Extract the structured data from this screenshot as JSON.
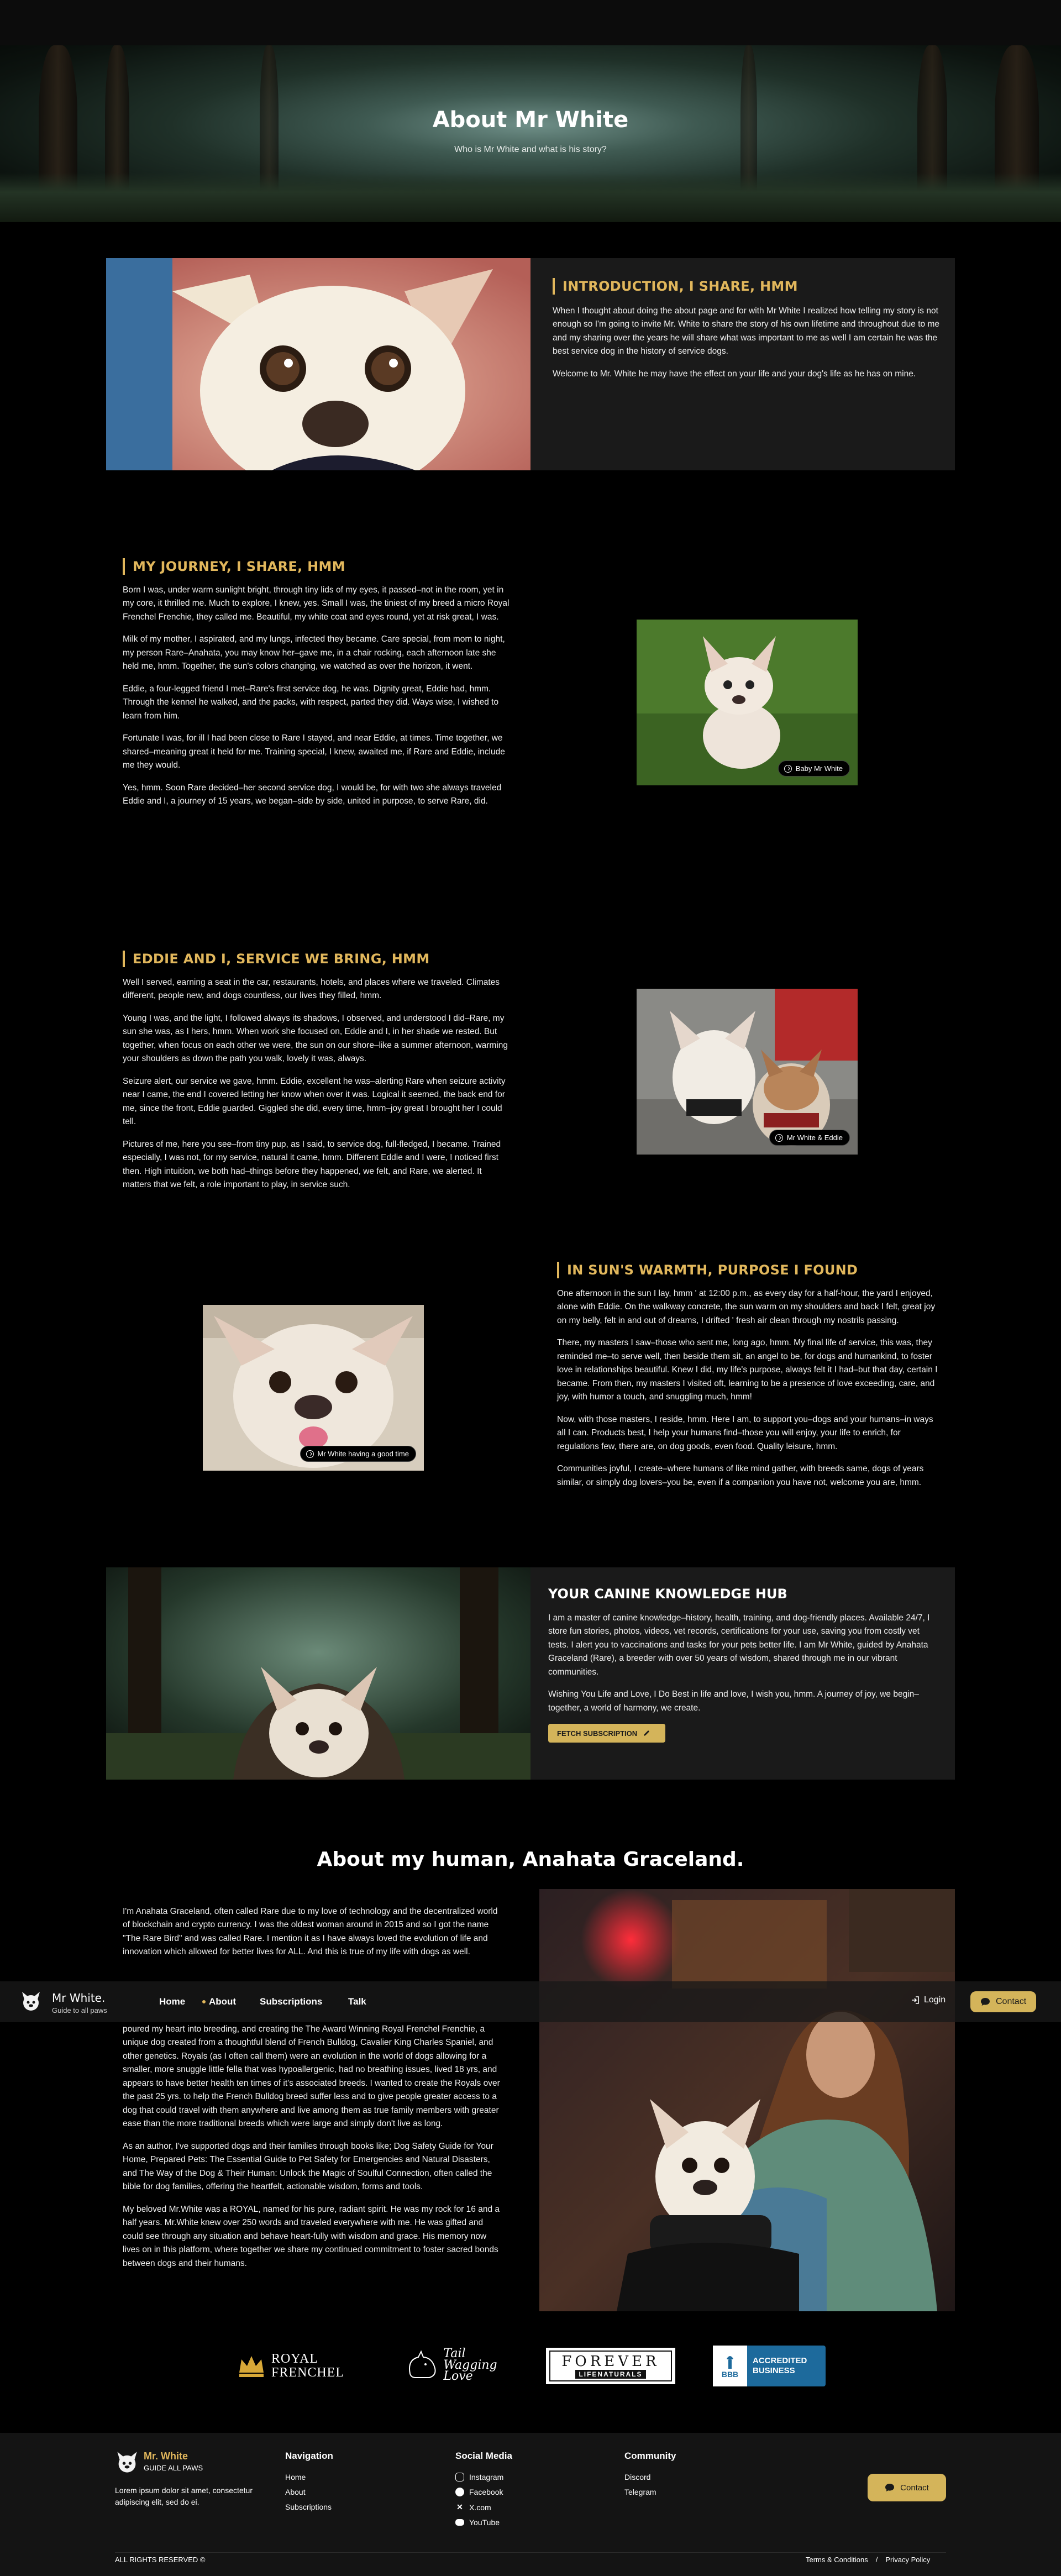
{
  "hero": {
    "title": "About Mr White",
    "subtitle": "Who is Mr White and what is his story?"
  },
  "intro": {
    "heading": "INTRODUCTION, I SHARE, HMM",
    "paragraphs": [
      "When I thought about doing the about page and for with Mr White I realized how telling my story is not enough so I'm going to invite Mr. White to share the story of his own lifetime and throughout due to me and my sharing over the years he will share what was important to me as well I am certain he was the best service dog in the history of service dogs.",
      "Welcome to Mr. White he may have the effect on your life and your dog's life as he has on mine."
    ]
  },
  "journey": {
    "heading": "MY JOURNEY, I SHARE, HMM",
    "paragraphs": [
      "Born I was, under warm sunlight bright, through tiny lids of my eyes, it passed–not in the room, yet in my core, it thrilled me. Much to explore, I knew, yes. Small I was, the tiniest of my breed a micro Royal Frenchel Frenchie, they called me. Beautiful, my white coat and eyes round, yet at risk great, I was.",
      "Milk of my mother, I aspirated, and my lungs, infected they became. Care special, from mom to night, my person Rare–Anahata, you may know her–gave me, in a chair rocking, each afternoon late she held me, hmm. Together, the sun's colors changing, we watched as over the horizon, it went.",
      "Eddie, a four-legged friend I met–Rare's first service dog, he was. Dignity great, Eddie had, hmm. Through the kennel he walked, and the packs, with respect, parted they did. Ways wise, I wished to learn from him.",
      "Fortunate I was, for ill I had been close to Rare I stayed, and near Eddie, at times. Time together, we shared–meaning great it held for me. Training special, I knew, awaited me, if Rare and Eddie, include me they would.",
      "Yes, hmm. Soon Rare decided–her second service dog, I would be, for with two she always traveled Eddie and I, a journey of 15 years, we began–side by side, united in purpose, to serve Rare, did."
    ],
    "caption": "Baby Mr White"
  },
  "eddie": {
    "heading": "EDDIE AND I, SERVICE WE BRING, HMM",
    "paragraphs": [
      "Well I served, earning a seat in the car, restaurants, hotels, and places where we traveled. Climates different, people new, and dogs countless, our lives they filled, hmm.",
      "Young I was, and the light, I followed always its shadows, I observed, and understood I did–Rare, my sun she was, as I hers, hmm. When work she focused on, Eddie and I, in her shade we rested. But together, when focus on each other we were, the sun on our shore–like a summer afternoon, warming your shoulders as down the path you walk, lovely it was, always.",
      "Seizure alert, our service we gave, hmm. Eddie, excellent he was–alerting Rare when seizure activity near I came, the end I covered letting her know when over it was. Logical it seemed, the back end for me, since the front, Eddie guarded. Giggled she did, every time, hmm–joy great I brought her I could tell.",
      "Pictures of me, here you see–from tiny pup, as I said, to service dog, full-fledged, I became. Trained especially, I was not, for my service, natural it came, hmm. Different Eddie and I were, I noticed first then. High intuition, we both had–things before they happened, we felt, and Rare, we alerted. It matters that we felt, a role important to play, in service such."
    ],
    "caption": "Mr White & Eddie"
  },
  "sun": {
    "heading": "IN SUN'S WARMTH, PURPOSE I FOUND",
    "paragraphs": [
      "One afternoon in the sun I lay, hmm ' at 12:00 p.m., as every day for a half-hour, the yard I enjoyed, alone with Eddie. On the walkway concrete, the sun warm on my shoulders and back I felt, great joy on my belly, felt in and out of dreams, I drifted ' fresh air clean through my nostrils passing.",
      "There, my masters I saw–those who sent me, long ago, hmm. My final life of service, this was, they reminded me–to serve well, then beside them sit, an angel to be, for dogs and humankind, to foster love in relationships beautiful. Knew I did, my life's purpose, always felt it I had–but that day, certain I became. From then, my masters I visited oft, learning to be a presence of love exceeding, care, and joy, with humor a touch, and snuggling much, hmm!",
      "Now, with those masters, I reside, hmm. Here I am, to support you–dogs and your humans–in ways all I can. Products best, I help your humans find–those you will enjoy, your life to enrich, for regulations few, there are, on dog goods, even food. Quality leisure, hmm.",
      "Communities joyful, I create–where humans of like mind gather, with breeds same, dogs of years similar, or simply dog lovers–you be, even if a companion you have not, welcome you are, hmm."
    ],
    "caption": "Mr White having a good time"
  },
  "hub": {
    "heading": "YOUR CANINE KNOWLEDGE HUB",
    "paragraphs": [
      "I am a master of canine knowledge–history, health, training, and dog-friendly places. Available 24/7, I store fun stories, photos, videos, vet records, certifications for your use, saving you from costly vet tests. I alert you to vaccinations and tasks for your pets better life. I am Mr White, guided by Anahata Graceland (Rare), a breeder with over 50 years of wisdom, shared through me in our vibrant communities.",
      "Wishing You Life and Love, I Do Best in life and love, I wish you, hmm. A journey of joy, we begin–together, a world of harmony, we create."
    ],
    "button": "FETCH SUBSCRIPTION"
  },
  "human": {
    "title": "About my human, Anahata Graceland.",
    "paragraphs_top": [
      "I'm Anahata Graceland, often called Rare due to my love of technology and the decentralized world of blockchain and crypto currency. I was the oldest woman around in 2015 and so I got the name \"The Rare Bird\" and was called Rare. I mention it as I have always loved the evolution of life and innovation which allowed for better lives for ALL. And this is true of my life with dogs as well."
    ],
    "paragraphs_bottom": [
      "poured my heart into breeding, and creating the The Award Winning Royal Frenchel Frenchie, a unique dog created from a thoughtful blend of French Bulldog, Cavalier King Charles Spaniel, and other genetics. Royals (as I often call them) were an evolution in the world of dogs allowing for a smaller, more snuggle little fella that was hypoallergenic, had no breathing issues, lived 18 yrs, and appears to have better health ten times of it's associated breeds. I wanted to create the Royals over the past 25 yrs. to help the French Bulldog breed suffer less and to give people greater access to a dog that could travel with them anywhere and live among them as true family members with greater ease than the more traditional breeds which were large and simply don't live as long.",
      "As an author, I've supported dogs and their families through books like; Dog Safety Guide for Your Home, Prepared Pets: The Essential Guide to Pet Safety for Emergencies and Natural Disasters, and The Way of the Dog & Their Human: Unlock the Magic of Soulful Connection, often called the bible for dog families, offering the heartfelt, actionable wisdom, forms and tools.",
      "My beloved Mr.White was a ROYAL, named for his pure, radiant spirit. He was my rock for 16 and a half years. Mr.White knew over 250 words and traveled everywhere with me. He was gifted and could see through any situation and behave heart-fully with wisdom and grace. His memory now lives on in this platform, where together we share my continued commitment to foster sacred bonds between dogs and their humans."
    ]
  },
  "nav": {
    "brand": "Mr White.",
    "tagline": "Guide to all paws",
    "links": [
      "Home",
      "About",
      "Subscriptions",
      "Talk"
    ],
    "login": "Login",
    "contact": "Contact"
  },
  "partners": {
    "royal_line1": "ROYAL",
    "royal_line2": "FRENCHEL",
    "tail_line1": "Tail",
    "tail_line2": "Wagging",
    "tail_line3": "Love",
    "forever_top": "FOREVER",
    "forever_bottom": "LIFENATURALS",
    "bbb_mark": "BBB",
    "bbb_line1": "ACCREDITED",
    "bbb_line2": "BUSINESS"
  },
  "footer": {
    "brand": "Mr. White",
    "brand_sub": "GUIDE ALL PAWS",
    "blurb": "Lorem ipsum dolor sit amet, consectetur adipiscing elit, sed do ei.",
    "navigation_title": "Navigation",
    "navigation": [
      "Home",
      "About",
      "Subscriptions"
    ],
    "social_title": "Social Media",
    "social": [
      "Instagram",
      "Facebook",
      "X.com",
      "YouTube"
    ],
    "community_title": "Community",
    "community": [
      "Discord",
      "Telegram"
    ],
    "contact": "Contact",
    "rights": "ALL RIGHTS RESERVED ©",
    "terms": "Terms & Conditions",
    "sep": "/",
    "privacy": "Privacy Policy"
  },
  "colors": {
    "gold": "#e1b75c",
    "card": "#1a1a1a",
    "bbb": "#1d6a9c"
  }
}
